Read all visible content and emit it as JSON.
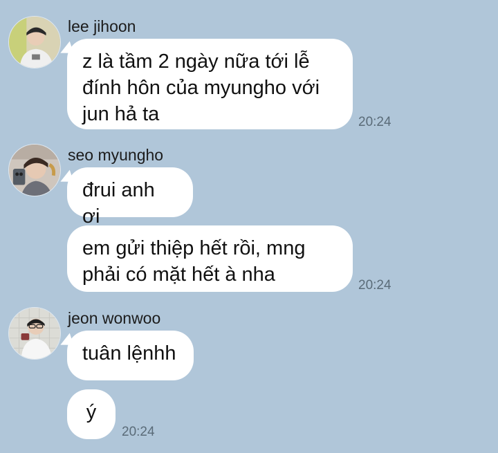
{
  "colors": {
    "background": "#b0c6d9",
    "bubble": "#ffffff",
    "text": "#111111",
    "timestamp": "#5a6b78"
  },
  "messages": [
    {
      "sender": "lee jihoon",
      "avatar_icon": "user-avatar-icon",
      "bubbles": [
        "z là tầm 2 ngày nữa tới lễ\nđính hôn của myungho với\njun hả ta"
      ],
      "time": "20:24"
    },
    {
      "sender": "seo myungho",
      "avatar_icon": "user-avatar-icon",
      "bubbles": [
        "đrui anh ơi",
        "em gửi thiệp hết rồi, mng\nphải có mặt hết à nha"
      ],
      "time": "20:24"
    },
    {
      "sender": "jeon wonwoo",
      "avatar_icon": "user-avatar-icon",
      "bubbles": [
        "tuân lệnhh",
        "ý"
      ],
      "time": "20:24"
    }
  ]
}
